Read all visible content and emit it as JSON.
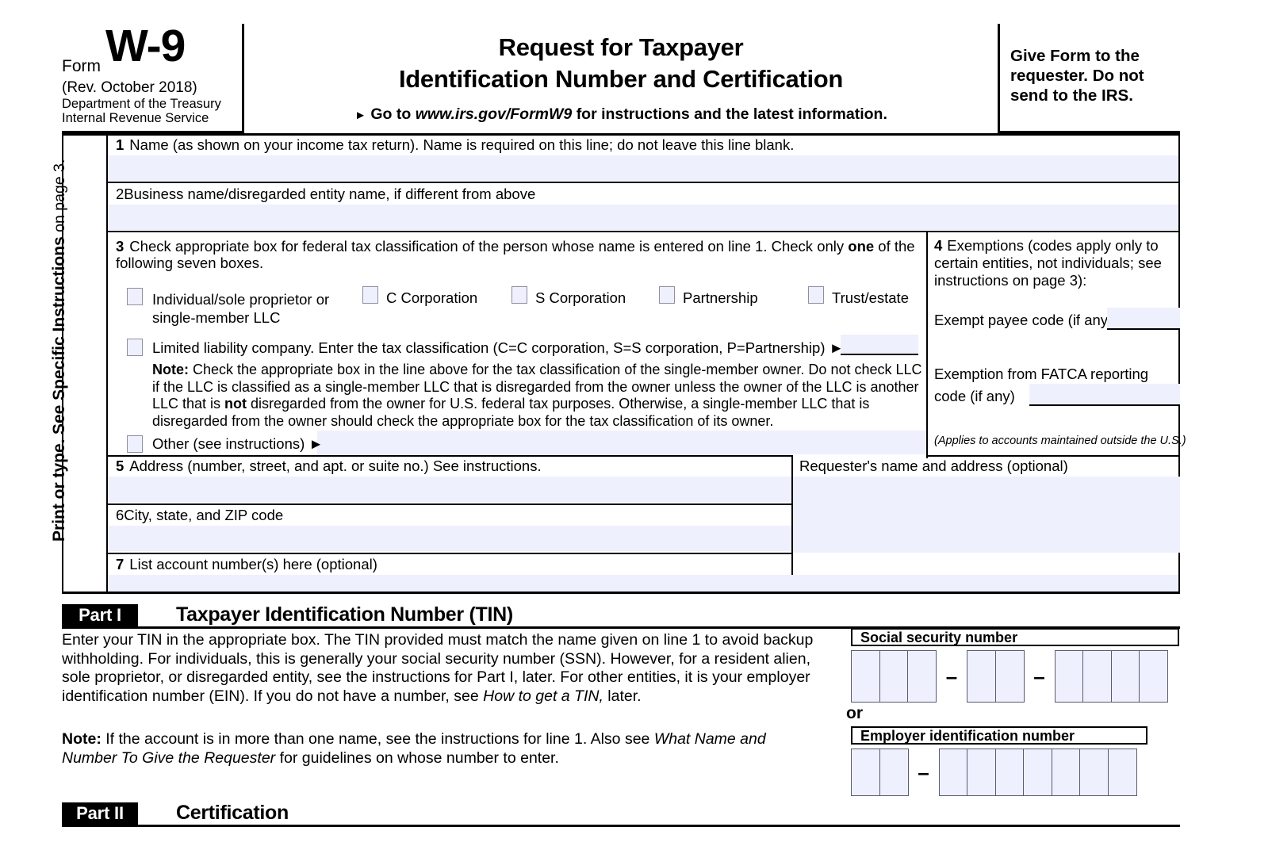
{
  "header": {
    "form_word": "Form",
    "form_number": "W-9",
    "revision": "(Rev. October 2018)",
    "department_line1": "Department of the Treasury",
    "department_line2": "Internal Revenue Service",
    "title_line1": "Request for Taxpayer",
    "title_line2": "Identification Number and Certification",
    "goto_prefix": "Go to",
    "goto_url": "www.irs.gov/FormW9",
    "goto_suffix": "for instructions and the latest information.",
    "give_form_note": "Give Form to the requester. Do not send to the IRS."
  },
  "sidebar": {
    "line1_bold": "Print or type.",
    "line2_bold": "See Specific Instructions",
    "line2_rest": " on page 3."
  },
  "line1": {
    "number": "1",
    "label": "Name (as shown on your income tax return). Name is required on this line; do not leave this line blank.",
    "value": ""
  },
  "line2": {
    "number": "2",
    "label": "Business name/disregarded entity name, if different from above",
    "value": ""
  },
  "line3": {
    "number": "3",
    "intro_a": "Check appropriate box for federal tax classification of the person whose name is entered on line 1. Check only ",
    "intro_bold": "one",
    "intro_b": " of the following seven boxes.",
    "checkboxes": [
      {
        "id": "individual",
        "label": "Individual/sole proprietor or single-member LLC",
        "checked": false
      },
      {
        "id": "c-corporation",
        "label": "C Corporation",
        "checked": false
      },
      {
        "id": "s-corporation",
        "label": "S Corporation",
        "checked": false
      },
      {
        "id": "partnership",
        "label": "Partnership",
        "checked": false
      },
      {
        "id": "trust-estate",
        "label": "Trust/estate",
        "checked": false
      }
    ],
    "llc": {
      "label": "Limited liability company. Enter the tax classification (C=C corporation, S=S corporation, P=Partnership)",
      "checked": false,
      "value": ""
    },
    "note_bold": "Note:",
    "note_a": " Check the appropriate box in the line above for the tax classification of the single-member owner.  Do not check LLC if the LLC is classified as a single-member LLC that is disregarded from the owner unless the owner of the LLC is another LLC that is ",
    "note_bold2": "not",
    "note_b": " disregarded from the owner for U.S. federal tax purposes. Otherwise, a single-member LLC that is disregarded from the owner should check the appropriate box for the tax classification of its owner.",
    "other": {
      "label": "Other (see instructions)",
      "checked": false,
      "value": ""
    }
  },
  "line4": {
    "number": "4",
    "label": "Exemptions (codes apply only to certain entities, not individuals; see instructions on page 3):",
    "exempt_payee_label": "Exempt payee code (if any)",
    "exempt_payee_value": "",
    "fatca_label": "Exemption from FATCA reporting code (if any)",
    "fatca_value": "",
    "applies_note": "(Applies to accounts maintained outside the U.S.)"
  },
  "line5": {
    "number": "5",
    "label": "Address (number, street, and apt. or suite no.) See instructions.",
    "value": ""
  },
  "line6": {
    "number": "6",
    "label": "City, state, and ZIP code",
    "value": ""
  },
  "line7": {
    "number": "7",
    "label": "List account number(s) here (optional)",
    "value": ""
  },
  "requester": {
    "label": "Requester's name and address (optional)",
    "value": ""
  },
  "part1": {
    "tag": "Part I",
    "title": "Taxpayer Identification Number (TIN)",
    "body_a": "Enter your TIN in the appropriate box. The TIN provided must match the name given on line 1 to avoid backup withholding. For individuals, this is generally your social security number (SSN). However, for a resident alien, sole proprietor, or disregarded entity, see the instructions for Part I, later. For other entities, it is your employer identification number (EIN). If you do not have a number, see ",
    "body_italic": "How to get a TIN,",
    "body_b": " later.",
    "note_bold": "Note:",
    "note_a": " If the account is in more than one name, see the instructions for line 1. Also see ",
    "note_italic": "What Name and Number To Give the Requester",
    "note_b": " for guidelines on whose number to enter.",
    "ssn_label": "Social security number",
    "ssn_groups": [
      3,
      2,
      4
    ],
    "ssn_separator": "–",
    "or_label": "or",
    "ein_label": "Employer identification number",
    "ein_groups": [
      2,
      7
    ],
    "ein_separator": "–"
  },
  "part2": {
    "tag": "Part II",
    "title": "Certification"
  },
  "colors": {
    "field_fill": "#eef0fd",
    "checkbox_border": "#8f8f9e",
    "rule": "#000000"
  }
}
